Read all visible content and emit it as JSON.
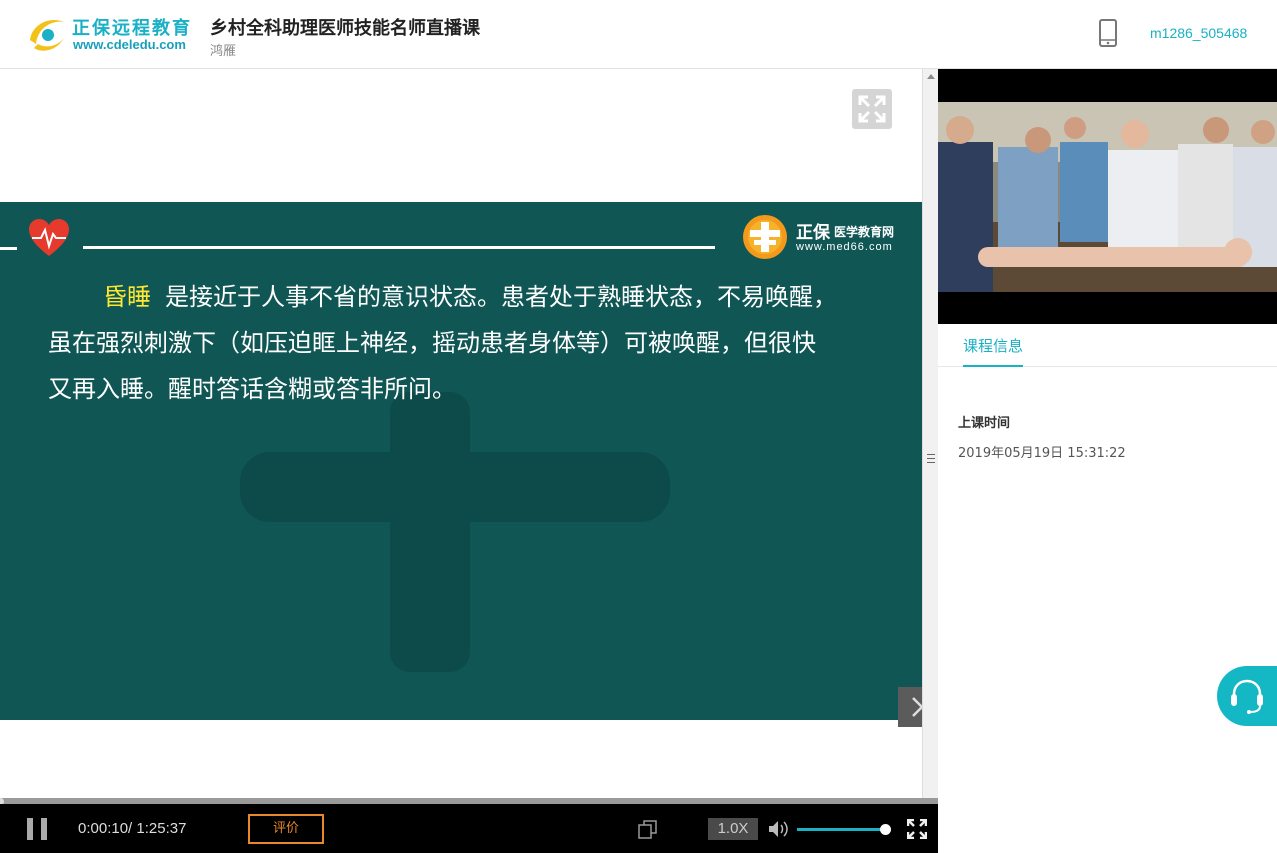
{
  "header": {
    "brand_name": "正保远程教育",
    "brand_url": "www.cdeledu.com",
    "course_title": "乡村全科助理医师技能名师直播课",
    "teacher": "鸿雁",
    "username": "m1286_505468"
  },
  "slide": {
    "logo_text_a": "正保",
    "logo_text_b": "医学教育网",
    "logo_url": "www.med66.com",
    "term": "昏睡",
    "line1": "是接近于人事不省的意识状态。患者处于熟睡状态，不易唤醒，",
    "line2": "虽在强烈刺激下（如压迫眶上神经，摇动患者身体等）可被唤醒，但很快",
    "line3": "又再入睡。醒时答话含糊或答非所问。"
  },
  "player": {
    "current_time": "0:00:10/",
    "total_time": "1:25:37",
    "rate_label": "评价",
    "speed": "1.0X",
    "progress": 0.002,
    "volume": 0.9
  },
  "sidebar": {
    "tab_label": "课程信息",
    "start_label": "上课时间",
    "start_value": "2019年05月19日 15:31:22"
  },
  "colors": {
    "accent": "#1ab0c6",
    "slide_bg": "#0f5654",
    "term": "#ffe82f",
    "rate_button": "#e8882c"
  },
  "icons": [
    "logo-icon",
    "phone-icon",
    "expand-icon",
    "heart-icon",
    "med66-logo-icon",
    "next-arrow-icon",
    "pause-icon",
    "copy-icon",
    "volume-icon",
    "fullscreen-icon",
    "headset-icon"
  ]
}
